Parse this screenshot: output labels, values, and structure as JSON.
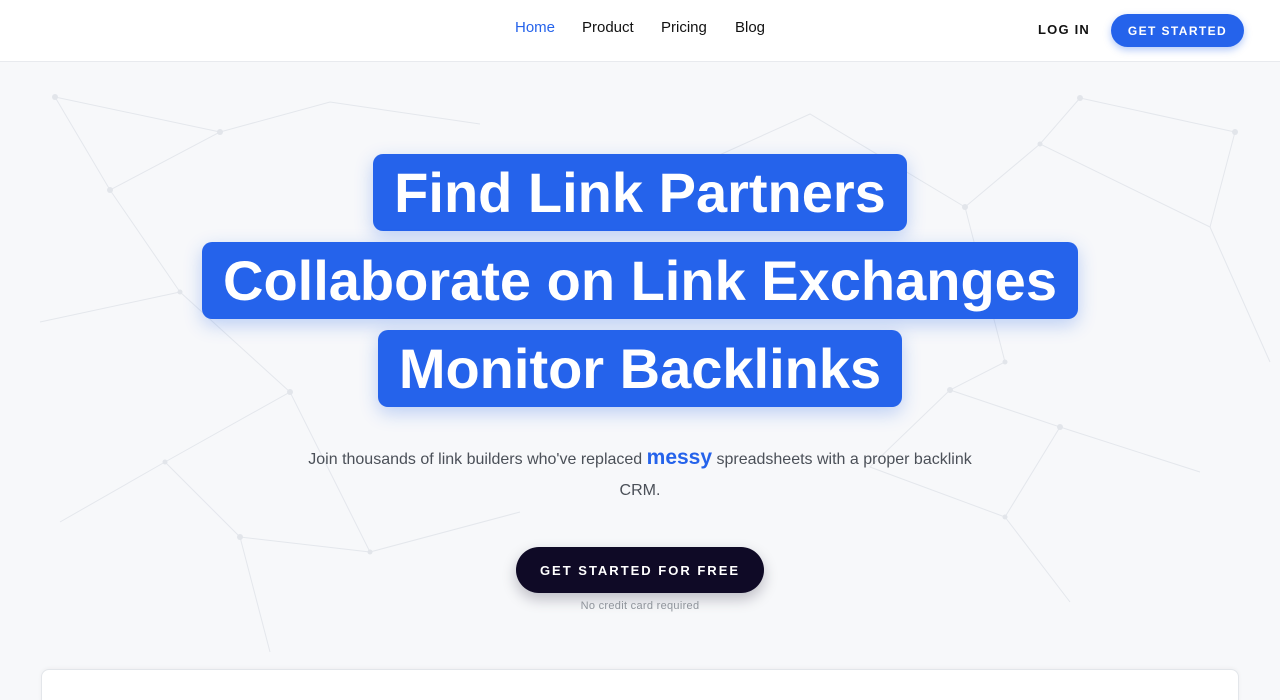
{
  "nav": {
    "items": [
      {
        "label": "Home",
        "active": true
      },
      {
        "label": "Product",
        "active": false
      },
      {
        "label": "Pricing",
        "active": false
      },
      {
        "label": "Blog",
        "active": false
      }
    ],
    "login_label": "LOG IN",
    "cta_label": "GET STARTED"
  },
  "hero": {
    "headlines": [
      "Find Link Partners",
      "Collaborate on Link Exchanges",
      "Monitor Backlinks"
    ],
    "subtitle_before": "Join thousands of link builders who've replaced ",
    "subtitle_emphasis": "messy",
    "subtitle_after": " spreadsheets with a proper backlink CRM.",
    "cta_label": "GET STARTED FOR FREE",
    "cta_note": "No credit card required"
  },
  "colors": {
    "accent": "#2563eb",
    "dark_button": "#0f0a26",
    "background": "#f7f8fa"
  }
}
